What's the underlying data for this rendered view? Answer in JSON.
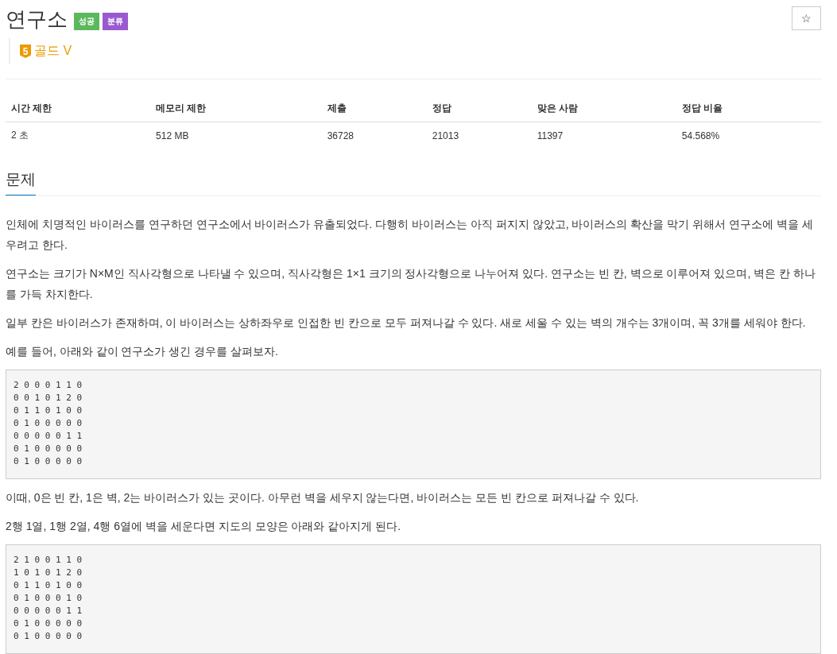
{
  "title": "연구소",
  "badges": [
    {
      "label": "성공",
      "color": "#5cb85c"
    },
    {
      "label": "분류",
      "color": "#9b59d0"
    }
  ],
  "star_button": "☆",
  "tier": {
    "number": "5",
    "label": "골드 V",
    "color": "#ec9a00"
  },
  "stats": {
    "columns": [
      "시간 제한",
      "메모리 제한",
      "제출",
      "정답",
      "맞은 사람",
      "정답 비율"
    ],
    "rows": [
      [
        "2 초",
        "512 MB",
        "36728",
        "21013",
        "11397",
        "54.568%"
      ]
    ]
  },
  "section_title": "문제",
  "content": [
    {
      "kind": "p",
      "text": "인체에 치명적인 바이러스를 연구하던 연구소에서 바이러스가 유출되었다. 다행히 바이러스는 아직 퍼지지 않았고, 바이러스의 확산을 막기 위해서 연구소에 벽을 세우려고 한다."
    },
    {
      "kind": "p",
      "text": "연구소는 크기가 N×M인 직사각형으로 나타낼 수 있으며, 직사각형은 1×1 크기의 정사각형으로 나누어져 있다. 연구소는 빈 칸, 벽으로 이루어져 있으며, 벽은 칸 하나를 가득 차지한다."
    },
    {
      "kind": "p",
      "text": "일부 칸은 바이러스가 존재하며, 이 바이러스는 상하좌우로 인접한 빈 칸으로 모두 퍼져나갈 수 있다. 새로 세울 수 있는 벽의 개수는 3개이며, 꼭 3개를 세워야 한다."
    },
    {
      "kind": "p",
      "text": "예를 들어, 아래와 같이 연구소가 생긴 경우를 살펴보자."
    },
    {
      "kind": "pre",
      "lines": [
        "2 0 0 0 1 1 0",
        "0 0 1 0 1 2 0",
        "0 1 1 0 1 0 0",
        "0 1 0 0 0 0 0",
        "0 0 0 0 0 1 1",
        "0 1 0 0 0 0 0",
        "0 1 0 0 0 0 0"
      ]
    },
    {
      "kind": "p",
      "text": "이때, 0은 빈 칸, 1은 벽, 2는 바이러스가 있는 곳이다. 아무런 벽을 세우지 않는다면, 바이러스는 모든 빈 칸으로 퍼져나갈 수 있다."
    },
    {
      "kind": "p",
      "text": "2행 1열, 1행 2열, 4행 6열에 벽을 세운다면 지도의 모양은 아래와 같아지게 된다."
    },
    {
      "kind": "pre",
      "lines": [
        "2 1 0 0 1 1 0",
        "1 0 1 0 1 2 0",
        "0 1 1 0 1 0 0",
        "0 1 0 0 0 1 0",
        "0 0 0 0 0 1 1",
        "0 1 0 0 0 0 0",
        "0 1 0 0 0 0 0"
      ]
    }
  ]
}
